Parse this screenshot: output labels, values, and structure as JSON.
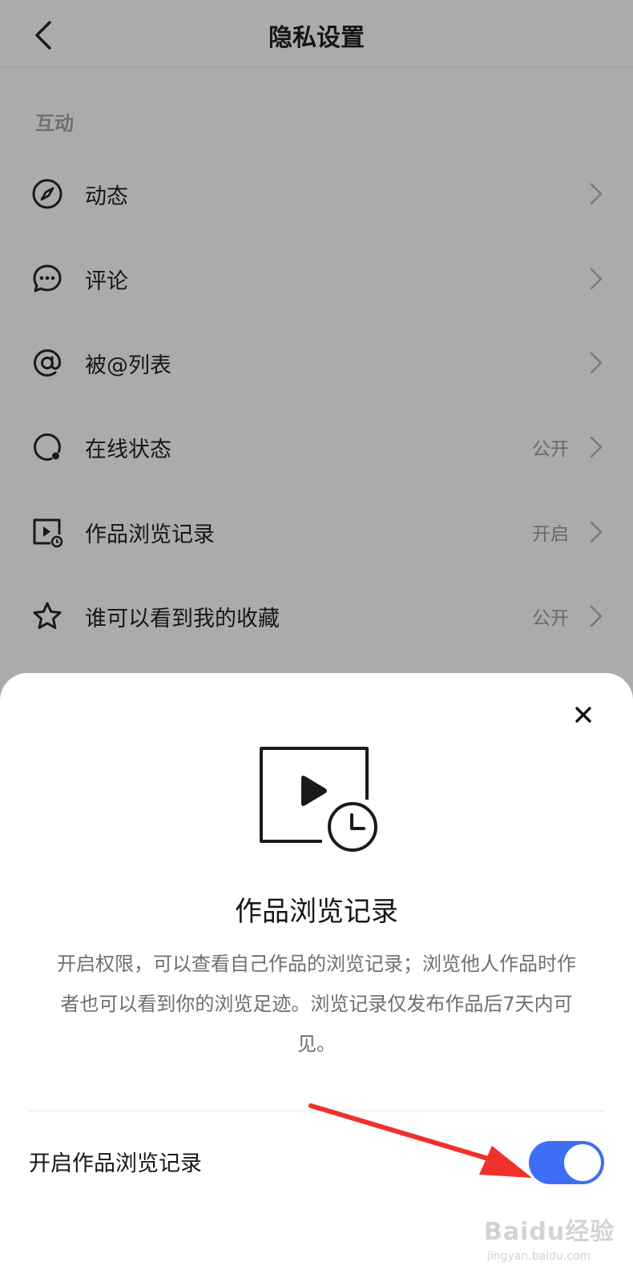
{
  "header": {
    "title": "隐私设置"
  },
  "section": {
    "label": "互动"
  },
  "rows": [
    {
      "label": "动态",
      "value": "",
      "icon": "compass-icon"
    },
    {
      "label": "评论",
      "value": "",
      "icon": "chat-bubble-icon"
    },
    {
      "label": "被@列表",
      "value": "",
      "icon": "at-sign-icon"
    },
    {
      "label": "在线状态",
      "value": "公开",
      "icon": "online-status-icon"
    },
    {
      "label": "作品浏览记录",
      "value": "开启",
      "icon": "video-history-icon"
    },
    {
      "label": "谁可以看到我的收藏",
      "value": "公开",
      "icon": "star-icon"
    }
  ],
  "sheet": {
    "title": "作品浏览记录",
    "description": "开启权限，可以查看自己作品的浏览记录；浏览他人作品时作者也可以看到你的浏览足迹。浏览记录仅发布作品后7天内可见。",
    "toggle_label": "开启作品浏览记录",
    "toggle_on": true,
    "hero_icon": "video-clock-icon"
  },
  "watermark": {
    "brand": "Baidu经验",
    "url": "jingyan.baidu.com"
  },
  "colors": {
    "accent": "#3d6ef5",
    "annotation": "#f0302a",
    "overlay": "#ababab"
  }
}
